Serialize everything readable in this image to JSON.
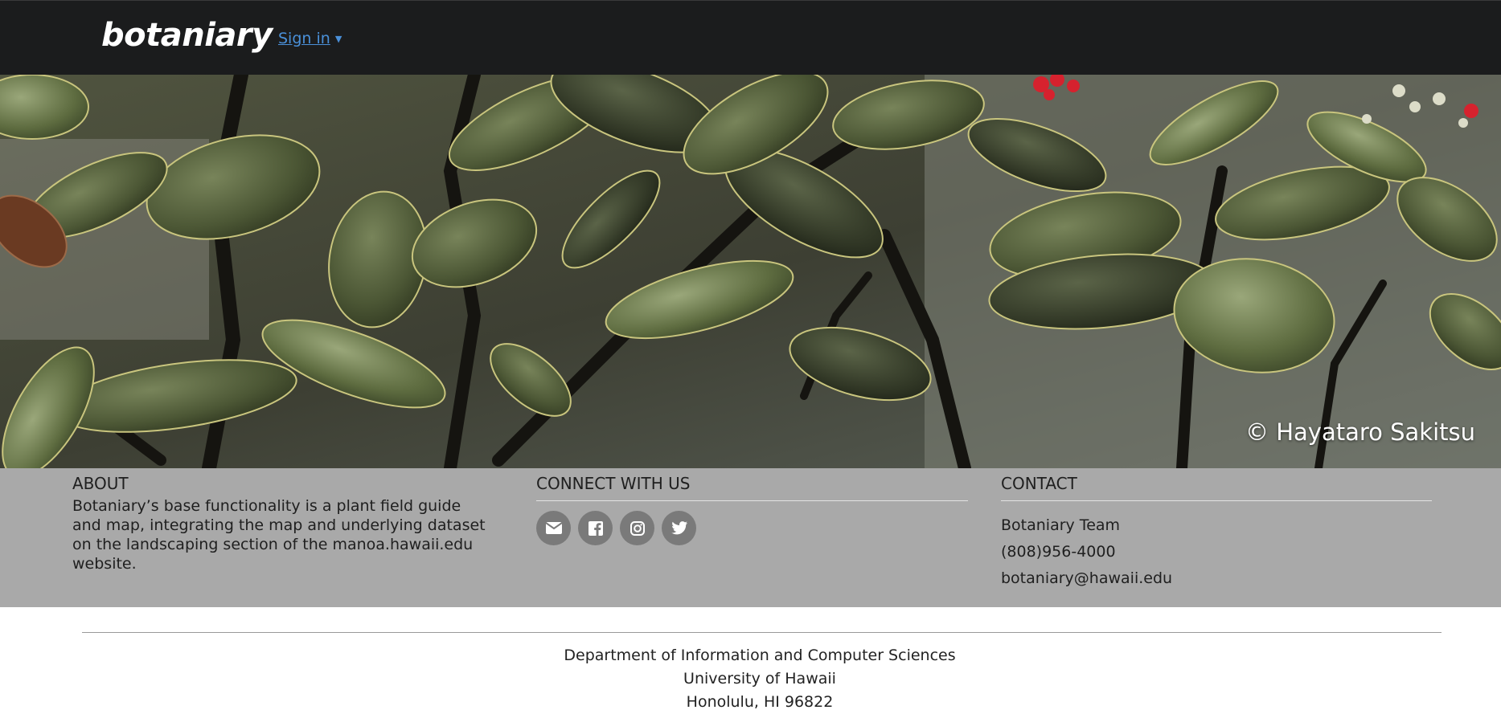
{
  "navbar": {
    "brand": "botaniary",
    "signin_label": "Sign in",
    "caret_icon": "caret-down-icon",
    "background": "#1b1c1d",
    "link_color": "#4a90d9"
  },
  "hero": {
    "image_description_icon": "plant-photo",
    "credit": "© Hayataro Sakitsu"
  },
  "footer": {
    "background": "#a9a9a9",
    "about": {
      "title": "ABOUT",
      "text": "Botaniary’s base functionality is a plant field guide and map, integrating the map and underlying dataset on the landscaping section of the manoa.hawaii.edu website."
    },
    "connect": {
      "title": "CONNECT WITH US",
      "icons": [
        "envelope-icon",
        "facebook-icon",
        "instagram-icon",
        "twitter-icon"
      ]
    },
    "contact": {
      "title": "CONTACT",
      "lines": [
        "Botaniary Team",
        "(808)956-4000",
        "botaniary@hawaii.edu"
      ]
    }
  },
  "address": {
    "lines": [
      "Department of Information and Computer Sciences",
      "University of Hawaii",
      "Honolulu, HI 96822"
    ]
  }
}
